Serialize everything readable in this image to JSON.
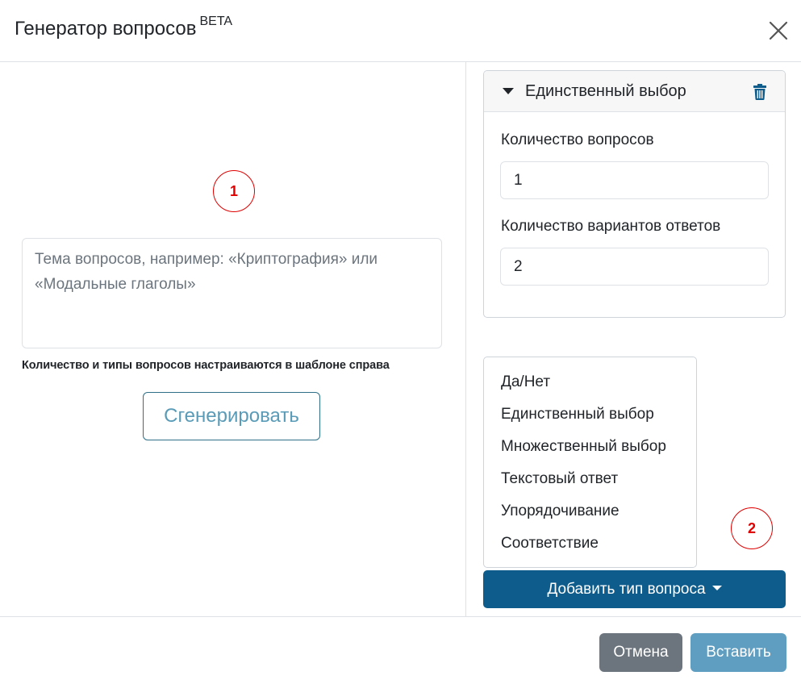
{
  "header": {
    "title": "Генератор вопросов",
    "badge": "BETA",
    "close_icon": "close-icon"
  },
  "left": {
    "marker": "1",
    "topic_placeholder": "Тема вопросов, например: «Криптография» или «Модальные глаголы»",
    "topic_value": "",
    "hint": "Количество и типы вопросов настраиваются в шаблоне справа",
    "generate_label": "Сгенерировать"
  },
  "template_card": {
    "title": "Единственный выбор",
    "caret_icon": "caret-down-icon",
    "trash_icon": "trash-icon",
    "questions_label": "Количество вопросов",
    "questions_value": "1",
    "answers_label": "Количество вариантов ответов",
    "answers_value": "2"
  },
  "question_types": {
    "items": [
      "Да/Нет",
      "Единственный выбор",
      "Множественный выбор",
      "Текстовый ответ",
      "Упорядочивание",
      "Соответствие"
    ]
  },
  "marker2": "2",
  "add_type_label": "Добавить тип вопроса",
  "footer": {
    "cancel_label": "Отмена",
    "insert_label": "Вставить"
  },
  "colors": {
    "primary": "#0d5c8c",
    "secondary": "#6c757d",
    "insert_disabled": "#5f9ec0",
    "marker": "#e00000"
  }
}
